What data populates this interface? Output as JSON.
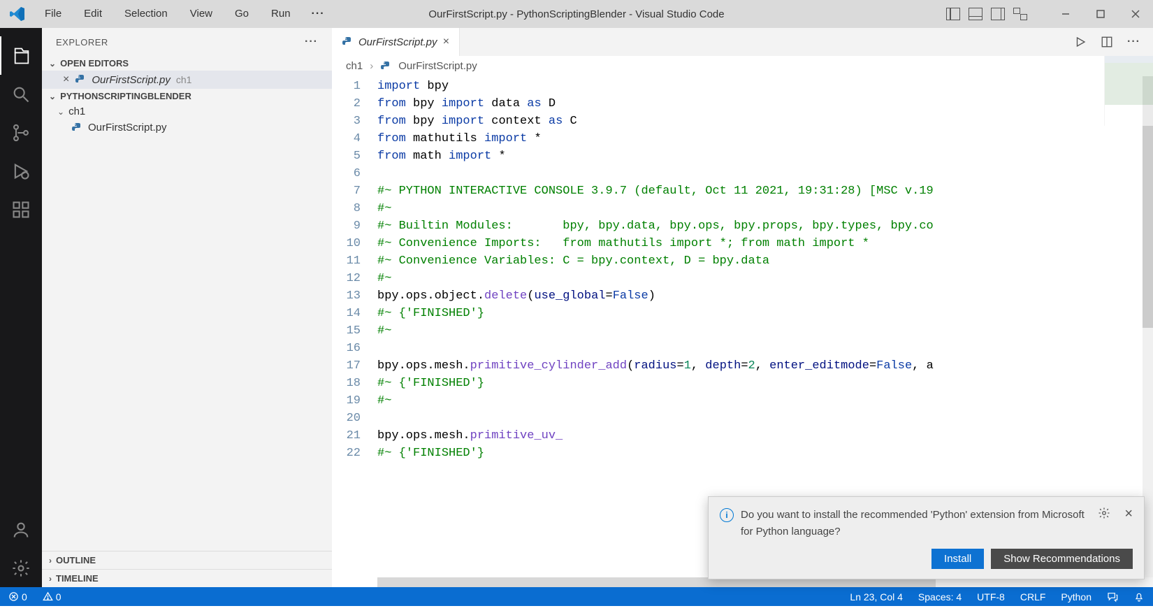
{
  "window": {
    "title": "OurFirstScript.py - PythonScriptingBlender - Visual Studio Code"
  },
  "menu": [
    "File",
    "Edit",
    "Selection",
    "View",
    "Go",
    "Run"
  ],
  "sidebar": {
    "title": "EXPLORER",
    "open_editors_label": "OPEN EDITORS",
    "open_editors": [
      {
        "name": "OurFirstScript.py",
        "dir": "ch1"
      }
    ],
    "workspace_label": "PYTHONSCRIPTINGBLENDER",
    "folders": [
      {
        "name": "ch1",
        "files": [
          "OurFirstScript.py"
        ]
      }
    ],
    "outline_label": "OUTLINE",
    "timeline_label": "TIMELINE"
  },
  "tab": {
    "name": "OurFirstScript.py"
  },
  "breadcrumb": {
    "parts": [
      "ch1",
      "OurFirstScript.py"
    ]
  },
  "code": {
    "lines": [
      [
        [
          "kw",
          "import"
        ],
        [
          "",
          " bpy"
        ]
      ],
      [
        [
          "kw",
          "from"
        ],
        [
          "",
          " bpy "
        ],
        [
          "kw",
          "import"
        ],
        [
          "",
          " data "
        ],
        [
          "kw",
          "as"
        ],
        [
          "",
          " D"
        ]
      ],
      [
        [
          "kw",
          "from"
        ],
        [
          "",
          " bpy "
        ],
        [
          "kw",
          "import"
        ],
        [
          "",
          " context "
        ],
        [
          "kw",
          "as"
        ],
        [
          "",
          " C"
        ]
      ],
      [
        [
          "kw",
          "from"
        ],
        [
          "",
          " mathutils "
        ],
        [
          "kw",
          "import"
        ],
        [
          "",
          " *"
        ]
      ],
      [
        [
          "kw",
          "from"
        ],
        [
          "",
          " math "
        ],
        [
          "kw",
          "import"
        ],
        [
          "",
          " *"
        ]
      ],
      [
        [
          "",
          ""
        ]
      ],
      [
        [
          "com",
          "#~ PYTHON INTERACTIVE CONSOLE 3.9.7 (default, Oct 11 2021, 19:31:28) [MSC v.19"
        ]
      ],
      [
        [
          "com",
          "#~"
        ]
      ],
      [
        [
          "com",
          "#~ Builtin Modules:       bpy, bpy.data, bpy.ops, bpy.props, bpy.types, bpy.co"
        ]
      ],
      [
        [
          "com",
          "#~ Convenience Imports:   from mathutils import *; from math import *"
        ]
      ],
      [
        [
          "com",
          "#~ Convenience Variables: C = bpy.context, D = bpy.data"
        ]
      ],
      [
        [
          "com",
          "#~"
        ]
      ],
      [
        [
          "",
          "bpy.ops.object."
        ],
        [
          "fn",
          "delete"
        ],
        [
          "",
          "("
        ],
        [
          "par",
          "use_global"
        ],
        [
          "",
          "="
        ],
        [
          "const",
          "False"
        ],
        [
          "",
          ")"
        ]
      ],
      [
        [
          "com",
          "#~ {'FINISHED'}"
        ]
      ],
      [
        [
          "com",
          "#~"
        ]
      ],
      [
        [
          "",
          ""
        ]
      ],
      [
        [
          "",
          "bpy.ops.mesh."
        ],
        [
          "fn",
          "primitive_cylinder_add"
        ],
        [
          "",
          "("
        ],
        [
          "par",
          "radius"
        ],
        [
          "",
          "="
        ],
        [
          "num",
          "1"
        ],
        [
          "",
          ", "
        ],
        [
          "par",
          "depth"
        ],
        [
          "",
          "="
        ],
        [
          "num",
          "2"
        ],
        [
          "",
          ", "
        ],
        [
          "par",
          "enter_editmode"
        ],
        [
          "",
          "="
        ],
        [
          "const",
          "False"
        ],
        [
          "",
          ", a"
        ]
      ],
      [
        [
          "com",
          "#~ {'FINISHED'}"
        ]
      ],
      [
        [
          "com",
          "#~"
        ]
      ],
      [
        [
          "",
          ""
        ]
      ],
      [
        [
          "",
          "bpy.ops.mesh."
        ],
        [
          "fn",
          "primitive_uv_"
        ]
      ],
      [
        [
          "com",
          "#~ {'FINISHED'}"
        ]
      ]
    ]
  },
  "notification": {
    "text": "Do you want to install the recommended 'Python' extension from Microsoft for Python language?",
    "install": "Install",
    "show_rec": "Show Recommendations"
  },
  "statusbar": {
    "errors": "0",
    "warnings": "0",
    "ln_col": "Ln 23, Col 4",
    "spaces": "Spaces: 4",
    "encoding": "UTF-8",
    "eol": "CRLF",
    "language": "Python"
  }
}
